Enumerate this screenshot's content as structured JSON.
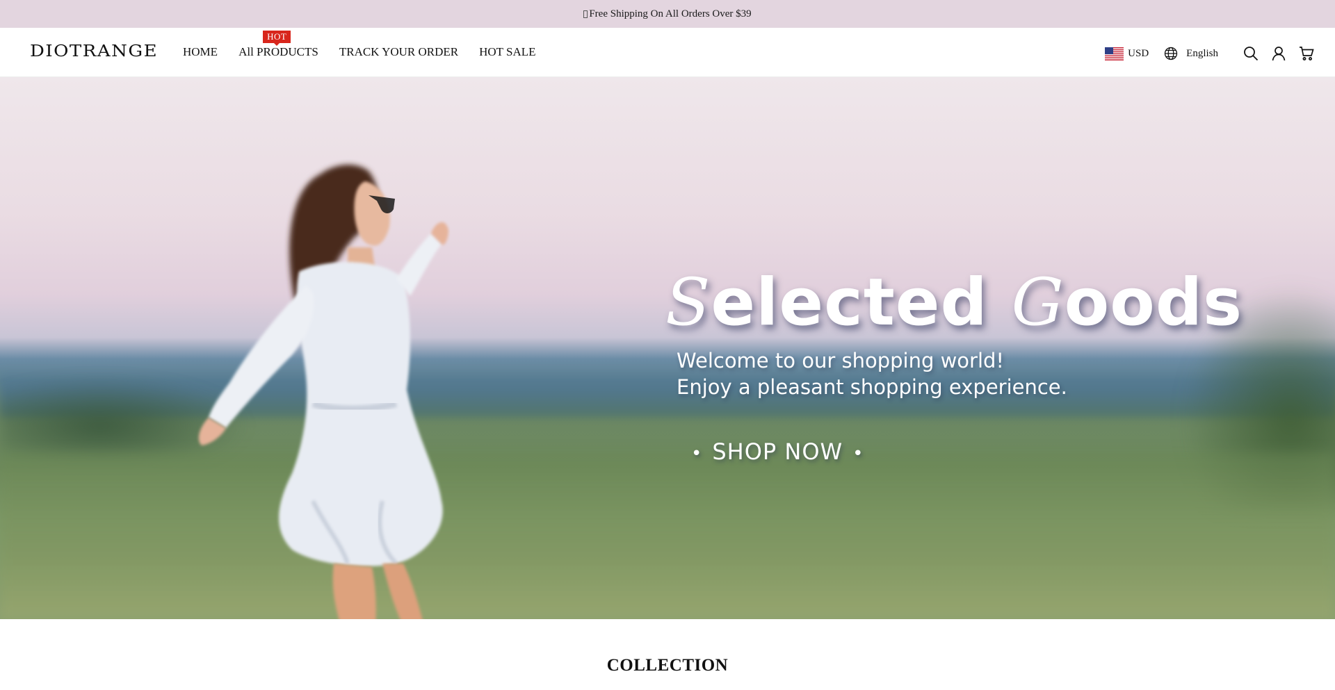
{
  "announcement": {
    "text": "Free Shipping On All Orders Over $39"
  },
  "header": {
    "logo": "DIOTRANGE",
    "nav": [
      {
        "label": "HOME"
      },
      {
        "label": "All PRODUCTS",
        "badge": "HOT"
      },
      {
        "label": "TRACK YOUR ORDER"
      },
      {
        "label": "HOT SALE"
      }
    ],
    "currency": "USD",
    "language": "English",
    "icons": [
      "us-flag-icon",
      "globe-icon",
      "search-icon",
      "account-icon",
      "cart-icon"
    ]
  },
  "hero": {
    "title_initial_1": "S",
    "title_rest_1": "elected",
    "title_initial_2": "G",
    "title_rest_2": "oods",
    "subtitle_line1": "Welcome to our shopping world!",
    "subtitle_line2": "Enjoy a pleasant shopping experience.",
    "cta": "SHOP NOW",
    "cta_bullet": "•"
  },
  "collection": {
    "title": "COLLECTION"
  },
  "colors": {
    "announcement_bg": "#e3d5df",
    "hot_badge": "#d8261c"
  }
}
